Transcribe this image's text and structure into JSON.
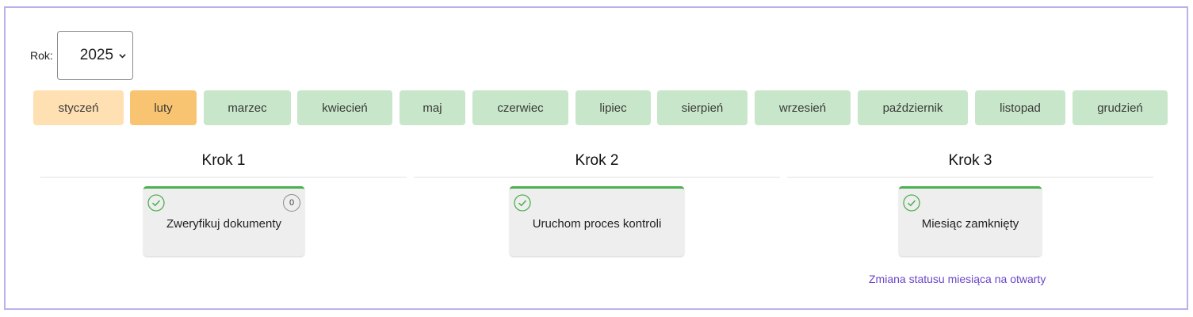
{
  "year": {
    "label": "Rok:",
    "value": "2025"
  },
  "months": [
    {
      "label": "styczeń",
      "state": "past"
    },
    {
      "label": "luty",
      "state": "current"
    },
    {
      "label": "marzec",
      "state": "future"
    },
    {
      "label": "kwiecień",
      "state": "future"
    },
    {
      "label": "maj",
      "state": "future"
    },
    {
      "label": "czerwiec",
      "state": "future"
    },
    {
      "label": "lipiec",
      "state": "future"
    },
    {
      "label": "sierpień",
      "state": "future"
    },
    {
      "label": "wrzesień",
      "state": "future"
    },
    {
      "label": "październik",
      "state": "future"
    },
    {
      "label": "listopad",
      "state": "future"
    },
    {
      "label": "grudzień",
      "state": "future"
    }
  ],
  "steps": [
    {
      "title": "Krok 1",
      "card_text": "Zweryfikuj dokumenty",
      "badge": "0",
      "icon": "check-circle-icon"
    },
    {
      "title": "Krok 2",
      "card_text": "Uruchom proces kontroli",
      "icon": "check-circle-icon"
    },
    {
      "title": "Krok 3",
      "card_text": "Miesiąc zamknięty",
      "icon": "check-circle-icon"
    }
  ],
  "status_link": "Zmiana statusu miesiąca na otwarty",
  "colors": {
    "frame_border": "#b9b1ec",
    "month_past": "#ffe0b2",
    "month_current": "#f8c471",
    "month_future": "#c8e6c9",
    "card_accent": "#4caf50",
    "link": "#6a45c9"
  }
}
